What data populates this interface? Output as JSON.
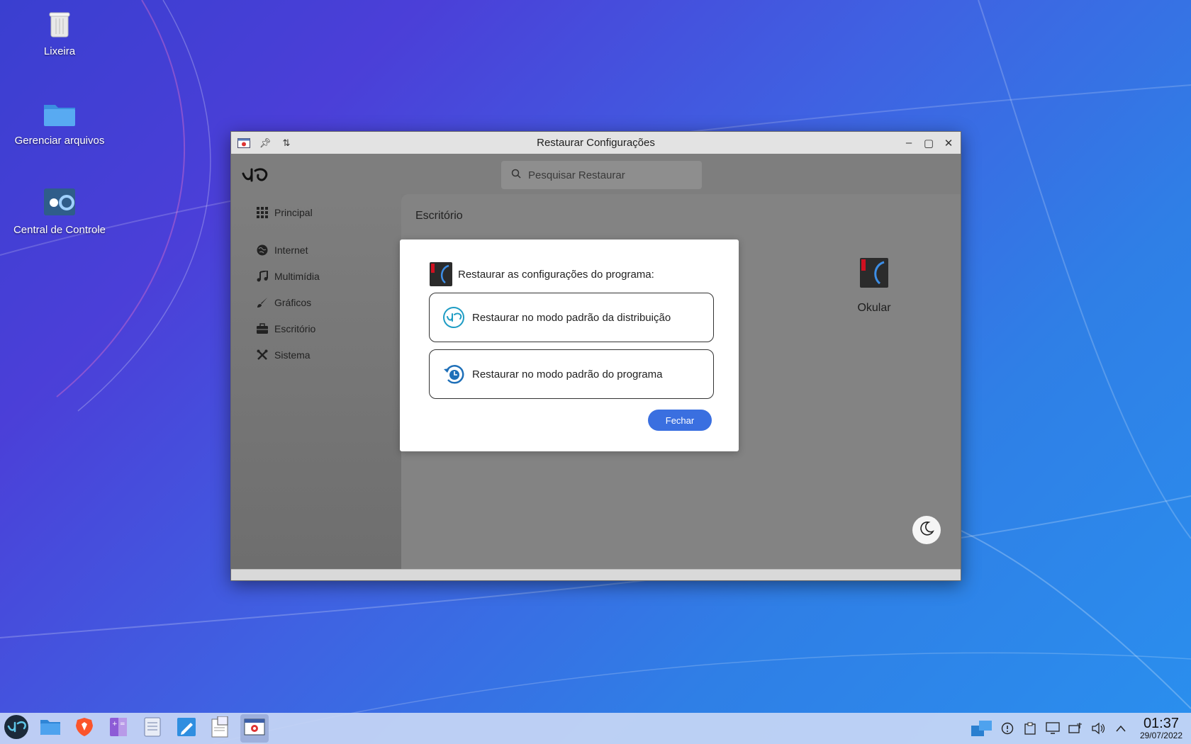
{
  "desktop": {
    "icons": [
      {
        "label": "Lixeira",
        "icon": "trash-icon"
      },
      {
        "label": "Gerenciar arquivos",
        "icon": "folder-icon"
      },
      {
        "label": "Central de Controle",
        "icon": "control-center-icon"
      }
    ]
  },
  "window": {
    "title": "Restaurar Configurações",
    "search_placeholder": "Pesquisar Restaurar",
    "sidebar": [
      {
        "label": "Principal",
        "icon": "grid-icon"
      },
      {
        "label": "Internet",
        "icon": "globe-icon"
      },
      {
        "label": "Multimídia",
        "icon": "music-note-icon"
      },
      {
        "label": "Gráficos",
        "icon": "brush-icon"
      },
      {
        "label": "Escritório",
        "icon": "briefcase-icon"
      },
      {
        "label": "Sistema",
        "icon": "tools-icon"
      }
    ],
    "section_title": "Escritório",
    "app_card": {
      "label": "Okular",
      "icon": "okular-icon"
    }
  },
  "dialog": {
    "heading": "Restaurar as configurações do programa:",
    "options": [
      {
        "label": "Restaurar no modo padrão da distribuição",
        "icon": "biglinux-logo-icon"
      },
      {
        "label": "Restaurar no modo padrão do programa",
        "icon": "restore-clock-icon"
      }
    ],
    "close_label": "Fechar",
    "accent": "#3a6fe0"
  },
  "taskbar": {
    "time": "01:37",
    "date": "29/07/2022"
  }
}
